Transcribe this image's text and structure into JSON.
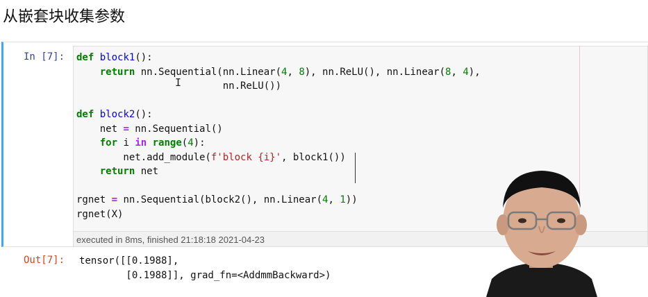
{
  "page": {
    "heading": "从嵌套块收集参数"
  },
  "cell": {
    "in_prompt": "In [7]:",
    "code_lines": [
      [
        {
          "t": "kw",
          "v": "def"
        },
        {
          "t": "",
          "v": " "
        },
        {
          "t": "fn",
          "v": "block1"
        },
        {
          "t": "",
          "v": "():"
        }
      ],
      [
        {
          "t": "",
          "v": "    "
        },
        {
          "t": "kw",
          "v": "return"
        },
        {
          "t": "",
          "v": " nn.Sequential(nn.Linear("
        },
        {
          "t": "num",
          "v": "4"
        },
        {
          "t": "",
          "v": ", "
        },
        {
          "t": "num",
          "v": "8"
        },
        {
          "t": "",
          "v": "), nn.ReLU(), nn.Linear("
        },
        {
          "t": "num",
          "v": "8"
        },
        {
          "t": "",
          "v": ", "
        },
        {
          "t": "num",
          "v": "4"
        },
        {
          "t": "",
          "v": "),"
        }
      ],
      [
        {
          "t": "",
          "v": "                         nn.ReLU())"
        }
      ],
      [],
      [
        {
          "t": "kw",
          "v": "def"
        },
        {
          "t": "",
          "v": " "
        },
        {
          "t": "fn",
          "v": "block2"
        },
        {
          "t": "",
          "v": "():"
        }
      ],
      [
        {
          "t": "",
          "v": "    net "
        },
        {
          "t": "op",
          "v": "="
        },
        {
          "t": "",
          "v": " nn.Sequential()"
        }
      ],
      [
        {
          "t": "",
          "v": "    "
        },
        {
          "t": "kw",
          "v": "for"
        },
        {
          "t": "",
          "v": " i "
        },
        {
          "t": "op",
          "v": "in"
        },
        {
          "t": "",
          "v": " "
        },
        {
          "t": "kw",
          "v": "range"
        },
        {
          "t": "",
          "v": "("
        },
        {
          "t": "num",
          "v": "4"
        },
        {
          "t": "",
          "v": "):"
        }
      ],
      [
        {
          "t": "",
          "v": "        net.add_module("
        },
        {
          "t": "str",
          "v": "f'block {i}'"
        },
        {
          "t": "",
          "v": ", block1())"
        }
      ],
      [
        {
          "t": "",
          "v": "    "
        },
        {
          "t": "kw",
          "v": "return"
        },
        {
          "t": "",
          "v": " net"
        }
      ],
      [],
      [
        {
          "t": "",
          "v": "rgnet "
        },
        {
          "t": "op",
          "v": "="
        },
        {
          "t": "",
          "v": " nn.Sequential(block2(), nn.Linear("
        },
        {
          "t": "num",
          "v": "4"
        },
        {
          "t": "",
          "v": ", "
        },
        {
          "t": "num",
          "v": "1"
        },
        {
          "t": "",
          "v": "))"
        }
      ],
      [
        {
          "t": "",
          "v": "rgnet(X)"
        }
      ]
    ],
    "exec_info": "executed in 8ms, finished 21:18:18 2021-04-23",
    "out_prompt": "Out[7]:",
    "output_lines": [
      "tensor([[0.1988],",
      "        [0.1988]], grad_fn=<AddmmBackward>)"
    ]
  },
  "colors": {
    "keyword": "#008000",
    "function": "#0000ff",
    "string": "#ba2121",
    "operator": "#aa22ff",
    "in_prompt": "#303f9f",
    "out_prompt": "#d84315",
    "cell_border": "#42a5f5"
  }
}
